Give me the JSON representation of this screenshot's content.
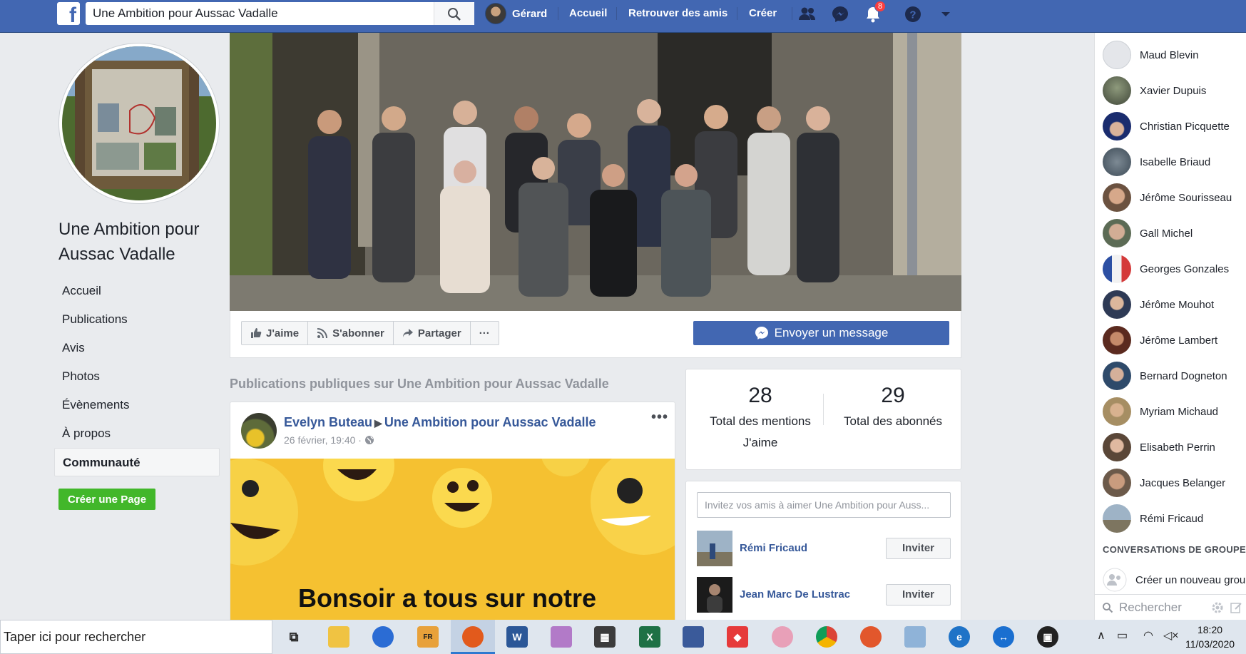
{
  "topbar": {
    "search_value": "Une Ambition pour Aussac Vadalle",
    "user_name": "Gérard",
    "nav": [
      "Accueil",
      "Retrouver des amis",
      "Créer"
    ],
    "notification_count": "8"
  },
  "page": {
    "name": "Une Ambition pour Aussac Vadalle",
    "nav_items": [
      "Accueil",
      "Publications",
      "Avis",
      "Photos",
      "Évènements",
      "À propos",
      "Communauté"
    ],
    "create_page_label": "Créer une Page"
  },
  "actions": {
    "like": "J'aime",
    "subscribe": "S'abonner",
    "share": "Partager",
    "more": "···",
    "message": "Envoyer un message"
  },
  "feed": {
    "section_title": "Publications publiques sur Une Ambition pour Aussac Vadalle",
    "post": {
      "author": "Evelyn Buteau",
      "target": "Une Ambition pour Aussac Vadalle",
      "time": "26 février, 19:40 ·",
      "image_text": "Bonsoir a tous sur notre"
    }
  },
  "stats": {
    "likes_count": "28",
    "likes_label": "Total des mentions J'aime",
    "followers_count": "29",
    "followers_label": "Total des abonnés"
  },
  "invite": {
    "placeholder": "Invitez vos amis à aimer Une Ambition pour Auss...",
    "friends": [
      {
        "name": "Rémi Fricaud",
        "button": "Inviter"
      },
      {
        "name": "Jean Marc De Lustrac",
        "button": "Inviter"
      }
    ]
  },
  "chat": {
    "contacts": [
      "Maud Blevin",
      "Xavier Dupuis",
      "Christian Picquette",
      "Isabelle Briaud",
      "Jérôme Sourisseau",
      "Gall Michel",
      "Georges Gonzales",
      "Jérôme Mouhot",
      "Jérôme Lambert",
      "Bernard Dogneton",
      "Myriam Michaud",
      "Elisabeth Perrin",
      "Jacques Belanger",
      "Rémi Fricaud"
    ],
    "group_section": "CONVERSATIONS DE GROUPE",
    "new_group": "Créer un nouveau grou",
    "search_placeholder": "Rechercher"
  },
  "taskbar": {
    "search_placeholder": "Taper ici pour rechercher",
    "time": "18:20",
    "date": "11/03/2020"
  },
  "colors": {
    "brand": "#4267b2",
    "link": "#365899",
    "green": "#42b72a",
    "notification": "#fa3e3e"
  }
}
